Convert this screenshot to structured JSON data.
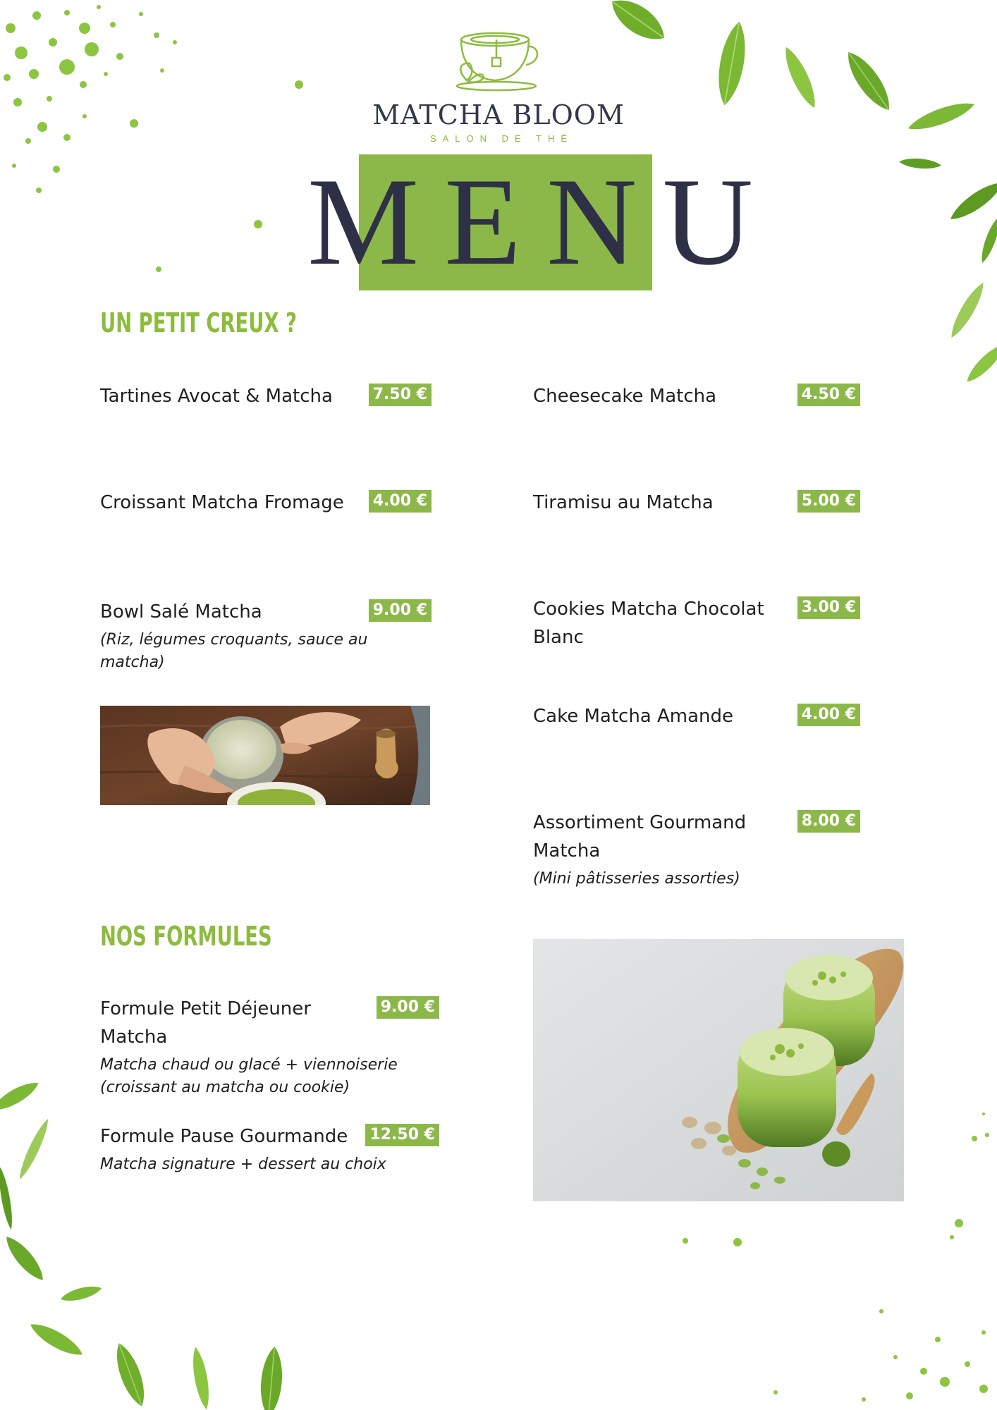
{
  "brand": {
    "name": "MATCHA BLOOM",
    "tagline": "SALON DE THÉ"
  },
  "menu_title": "MENU",
  "sections": {
    "snacks": {
      "title": "UN PETIT CREUX ?",
      "items": [
        {
          "name": "Tartines Avocat & Matcha",
          "price": "7.50 €"
        },
        {
          "name": "Croissant Matcha Fromage",
          "price": "4.00 €"
        },
        {
          "name": "Bowl Salé Matcha",
          "price": "9.00 €",
          "description": "(Riz, légumes croquants, sauce au matcha)"
        },
        {
          "name": "Cheesecake Matcha",
          "price": "4.50 €"
        },
        {
          "name": "Tiramisu au Matcha",
          "price": "5.00 €"
        },
        {
          "name": "Cookies Matcha Chocolat Blanc",
          "price": "3.00 €"
        },
        {
          "name": "Cake Matcha Amande",
          "price": "4.00 €"
        },
        {
          "name": "Assortiment Gourmand Matcha",
          "price": "8.00 €",
          "description": "(Mini pâtisseries assorties)"
        }
      ]
    },
    "formulas": {
      "title": "NOS FORMULES",
      "items": [
        {
          "name": "Formule Petit Déjeuner Matcha",
          "price": "9.00 €",
          "description": "Matcha chaud ou glacé + viennoiserie (croissant au matcha ou cookie)"
        },
        {
          "name": "Formule Pause Gourmande",
          "price": "12.50 €",
          "description": "Matcha signature + dessert au choix"
        }
      ]
    }
  },
  "colors": {
    "accent_green": "#8cb84a",
    "heading_green": "#8cbc3c",
    "dark_navy": "#2e3145",
    "text": "#1f1f1f"
  },
  "images": {
    "photo_1": "hands-holding-matcha-latte-photo",
    "photo_2": "iced-matcha-drinks-with-pistachios-photo"
  },
  "decorations": [
    "green-leaves",
    "green-paint-splatter"
  ]
}
